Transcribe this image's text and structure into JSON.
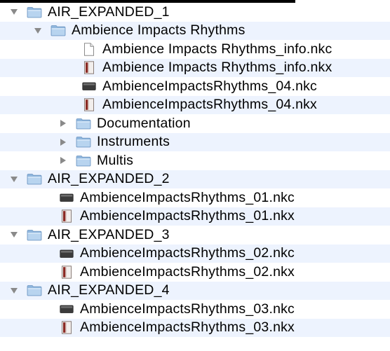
{
  "tree": [
    {
      "label": "AIR_EXPANDED_1",
      "type": "folder",
      "expanded": true,
      "level": 0,
      "icon": "folder-icon"
    },
    {
      "label": "Ambience Impacts Rhythms",
      "type": "folder",
      "expanded": true,
      "level": 1,
      "icon": "folder-icon"
    },
    {
      "label": "Ambience Impacts Rhythms_info.nkc",
      "type": "file",
      "level": 2,
      "icon": "document-icon"
    },
    {
      "label": "Ambience Impacts Rhythms_info.nkx",
      "type": "file",
      "level": 2,
      "icon": "nkx-file-icon"
    },
    {
      "label": "AmbienceImpactsRhythms_04.nkc",
      "type": "file",
      "level": 2,
      "icon": "nkc-file-icon"
    },
    {
      "label": "AmbienceImpactsRhythms_04.nkx",
      "type": "file",
      "level": 2,
      "icon": "nkx-file-icon"
    },
    {
      "label": "Documentation",
      "type": "folder",
      "expanded": false,
      "level": 2,
      "icon": "folder-icon"
    },
    {
      "label": "Instruments",
      "type": "folder",
      "expanded": false,
      "level": 2,
      "icon": "folder-icon"
    },
    {
      "label": "Multis",
      "type": "folder",
      "expanded": false,
      "level": 2,
      "icon": "folder-icon"
    },
    {
      "label": "AIR_EXPANDED_2",
      "type": "folder",
      "expanded": true,
      "level": 0,
      "icon": "folder-icon"
    },
    {
      "label": "AmbienceImpactsRhythms_01.nkc",
      "type": "file",
      "level": 1,
      "icon": "nkc-file-icon"
    },
    {
      "label": "AmbienceImpactsRhythms_01.nkx",
      "type": "file",
      "level": 1,
      "icon": "nkx-file-icon"
    },
    {
      "label": "AIR_EXPANDED_3",
      "type": "folder",
      "expanded": true,
      "level": 0,
      "icon": "folder-icon"
    },
    {
      "label": "AmbienceImpactsRhythms_02.nkc",
      "type": "file",
      "level": 1,
      "icon": "nkc-file-icon"
    },
    {
      "label": "AmbienceImpactsRhythms_02.nkx",
      "type": "file",
      "level": 1,
      "icon": "nkx-file-icon"
    },
    {
      "label": "AIR_EXPANDED_4",
      "type": "folder",
      "expanded": true,
      "level": 0,
      "icon": "folder-icon"
    },
    {
      "label": "AmbienceImpactsRhythms_03.nkc",
      "type": "file",
      "level": 1,
      "icon": "nkc-file-icon"
    },
    {
      "label": "AmbienceImpactsRhythms_03.nkx",
      "type": "file",
      "level": 1,
      "icon": "nkx-file-icon"
    }
  ],
  "colors": {
    "row_alt": "#edf3fe",
    "folder_blue": "#9fc3e6",
    "triangle_gray": "#8a8a8a"
  }
}
